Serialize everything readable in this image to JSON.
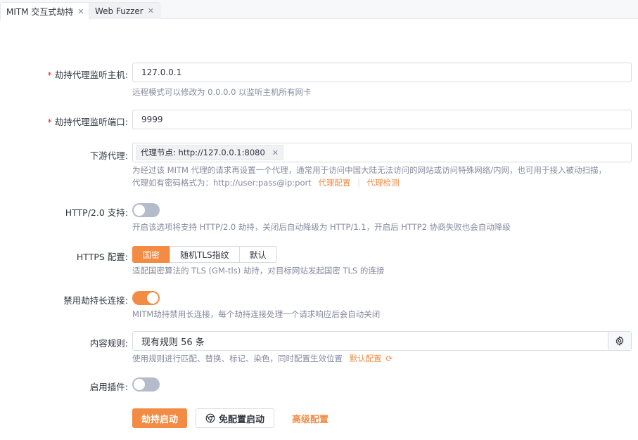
{
  "tabs": [
    {
      "label": "MITM 交互式劫持",
      "active": true
    },
    {
      "label": "Web Fuzzer",
      "active": false
    }
  ],
  "form": {
    "host": {
      "required_mark": "*",
      "label": "劫持代理监听主机:",
      "value": "127.0.0.1",
      "help": "远程模式可以修改为 0.0.0.0 以监听主机所有网卡"
    },
    "port": {
      "required_mark": "*",
      "label": "劫持代理监听端口:",
      "value": "9999"
    },
    "downstream": {
      "label": "下游代理:",
      "tag": "代理节点: http://127.0.0.1:8080",
      "help_line1": "为经过该 MITM 代理的请求再设置一个代理，通常用于访问中国大陆无法访问的网站或访问特殊网络/内网，也可用于接入被动扫描，",
      "help_line2": "代理如有密码格式为：http://user:pass@ip:port",
      "link_config": "代理配置",
      "link_check": "代理检测"
    },
    "http2": {
      "label": "HTTP/2.0 支持:",
      "enabled": false,
      "help": "开启该选项将支持 HTTP/2.0 劫持，关闭后自动降级为 HTTP/1.1，开启后 HTTP2 协商失败也会自动降级"
    },
    "https": {
      "label": "HTTPS 配置:",
      "options": [
        "国密",
        "随机TLS指纹",
        "默认"
      ],
      "selected": "国密",
      "help": "适配国密算法的 TLS (GM-tls) 劫持，对目标网站发起国密 TLS 的连接"
    },
    "keepalive": {
      "label": "禁用劫持长连接:",
      "enabled": true,
      "help": "MITM劫持禁用长连接，每个劫持连接处理一个请求响应后会自动关闭"
    },
    "rules": {
      "label": "内容规则:",
      "value": "现有规则 56 条",
      "help": "使用规则进行匹配、替换、标记、染色，同时配置生效位置",
      "link_default": "默认配置"
    },
    "plugins": {
      "label": "启用插件:",
      "enabled": false
    }
  },
  "actions": {
    "start": "劫持启动",
    "no_config_start": "免配置启动",
    "advanced": "高级配置"
  },
  "colors": {
    "accent": "#f28b44",
    "required": "#f5222d",
    "help_text": "#85899e",
    "border": "#d9dbe3"
  }
}
